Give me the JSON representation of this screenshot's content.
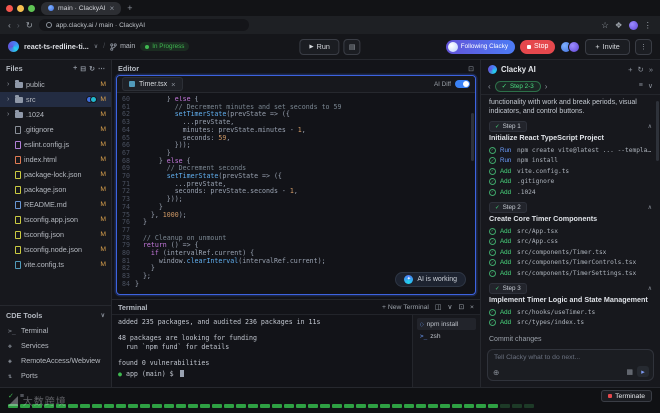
{
  "browser": {
    "tab_title": "main · ClackyAI",
    "url": "app.clacky.ai / main · ClackyAI"
  },
  "toolbar": {
    "project_name": "react-ts-redline-ti...",
    "branch": "main",
    "status_badge": "In Progress",
    "run_label": "Run",
    "following_label": "Following Clacky",
    "stop_label": "Stop",
    "invite_label": "Invite"
  },
  "files": {
    "title": "Files",
    "items": [
      {
        "name": "public",
        "type": "folder",
        "badge": "M",
        "color": "#8f98a8"
      },
      {
        "name": "src",
        "type": "folder",
        "badge": "M",
        "color": "#8f98a8",
        "selected": true,
        "avatars": true
      },
      {
        "name": ".1024",
        "type": "folder",
        "badge": "M",
        "color": "#8f98a8"
      },
      {
        "name": ".gitignore",
        "type": "file",
        "badge": "M",
        "color": "#8a8f98"
      },
      {
        "name": "eslint.config.js",
        "type": "file",
        "badge": "M",
        "color": "#b180d7"
      },
      {
        "name": "index.html",
        "type": "file",
        "badge": "M",
        "color": "#e07b53"
      },
      {
        "name": "package-lock.json",
        "type": "file",
        "badge": "M",
        "color": "#cbcb41"
      },
      {
        "name": "package.json",
        "type": "file",
        "badge": "M",
        "color": "#cbcb41"
      },
      {
        "name": "README.md",
        "type": "file",
        "badge": "M",
        "color": "#6997d5"
      },
      {
        "name": "tsconfig.app.json",
        "type": "file",
        "badge": "M",
        "color": "#cbcb41"
      },
      {
        "name": "tsconfig.json",
        "type": "file",
        "badge": "M",
        "color": "#cbcb41"
      },
      {
        "name": "tsconfig.node.json",
        "type": "file",
        "badge": "M",
        "color": "#cbcb41"
      },
      {
        "name": "vite.config.ts",
        "type": "file",
        "badge": "M",
        "color": "#519aba"
      }
    ]
  },
  "cde_tools": {
    "title": "CDE Tools",
    "items": [
      {
        "label": "Terminal",
        "icon": "terminal-icon",
        "glyph": ">_"
      },
      {
        "label": "Services",
        "icon": "services-icon",
        "glyph": "❖"
      },
      {
        "label": "RemoteAccess/Webview",
        "icon": "webview-icon",
        "glyph": "◈"
      },
      {
        "label": "Ports",
        "icon": "ports-icon",
        "glyph": "⇅"
      }
    ]
  },
  "editor": {
    "panel_title": "Editor",
    "tab_name": "Timer.tsx",
    "toggle_label": "AI Diff",
    "ai_status": "AI is working",
    "code_lines": [
      {
        "n": 60,
        "t": "        } else {"
      },
      {
        "n": 61,
        "t": "          // Decrement minutes and set seconds to 59"
      },
      {
        "n": 62,
        "t": "          setTimerState(prevState => ({"
      },
      {
        "n": 63,
        "t": "            ...prevState,"
      },
      {
        "n": 64,
        "t": "            minutes: prevState.minutes - 1,"
      },
      {
        "n": 65,
        "t": "            seconds: 59,"
      },
      {
        "n": 66,
        "t": "          }));"
      },
      {
        "n": 67,
        "t": "        }"
      },
      {
        "n": 68,
        "t": "      } else {"
      },
      {
        "n": 69,
        "t": "        // Decrement seconds"
      },
      {
        "n": 70,
        "t": "        setTimerState(prevState => ({"
      },
      {
        "n": 71,
        "t": "          ...prevState,"
      },
      {
        "n": 72,
        "t": "          seconds: prevState.seconds - 1,"
      },
      {
        "n": 73,
        "t": "        }));"
      },
      {
        "n": 74,
        "t": "      }"
      },
      {
        "n": 75,
        "t": "    }, 1000);"
      },
      {
        "n": 76,
        "t": "  }"
      },
      {
        "n": 77,
        "t": ""
      },
      {
        "n": 78,
        "t": "  // Cleanup on unmount"
      },
      {
        "n": 79,
        "t": "  return () => {"
      },
      {
        "n": 80,
        "t": "    if (intervalRef.current) {"
      },
      {
        "n": 81,
        "t": "      window.clearInterval(intervalRef.current);"
      },
      {
        "n": 82,
        "t": "    }"
      },
      {
        "n": 83,
        "t": "  };"
      },
      {
        "n": 84,
        "t": "}"
      }
    ]
  },
  "terminal": {
    "panel_title": "Terminal",
    "new_terminal_label": "New Terminal",
    "lines": [
      "added 235 packages, and audited 236 packages in 11s",
      "",
      "48 packages are looking for funding",
      "  run `npm fund` for details",
      "",
      "found 0 vulnerabilities"
    ],
    "prompt": "app (main) $",
    "sessions": [
      {
        "name": "npm install",
        "icon": "spinner-icon",
        "glyph": "◌"
      },
      {
        "name": "zsh",
        "icon": "shell-icon",
        "glyph": ">_"
      }
    ]
  },
  "assistant": {
    "title": "Clacky AI",
    "step_badge": "Step 2-3",
    "intro": "functionality with work and break periods, visual indicators, and control buttons.",
    "steps": [
      {
        "label": "Step 1",
        "title": "Initialize React TypeScript Project",
        "items": [
          {
            "action": "Run",
            "text": "npm create vite@latest ... --template..."
          },
          {
            "action": "Run",
            "text": "npm install"
          },
          {
            "action": "Add",
            "text": "vite.config.ts"
          },
          {
            "action": "Add",
            "text": ".gitignore"
          },
          {
            "action": "Add",
            "text": ".1024"
          }
        ]
      },
      {
        "label": "Step 2",
        "title": "Create Core Timer Components",
        "items": [
          {
            "action": "Add",
            "text": "src/App.tsx"
          },
          {
            "action": "Add",
            "text": "src/App.css"
          },
          {
            "action": "Add",
            "text": "src/components/Timer.tsx"
          },
          {
            "action": "Add",
            "text": "src/components/TimerControls.tsx"
          },
          {
            "action": "Add",
            "text": "src/components/TimerSettings.tsx"
          }
        ]
      },
      {
        "label": "Step 3",
        "title": "Implement Timer Logic and State Management",
        "items": [
          {
            "action": "Add",
            "text": "src/hooks/useTimer.ts"
          },
          {
            "action": "Add",
            "text": "src/types/index.ts"
          }
        ]
      }
    ],
    "commit_label": "Commit changes",
    "input_placeholder": "Tell Clacky what to do next..."
  },
  "status_bar": {
    "terminate_label": "Terminate",
    "progress": {
      "total": 44,
      "filled": 41
    }
  },
  "watermark": "大数跨境"
}
